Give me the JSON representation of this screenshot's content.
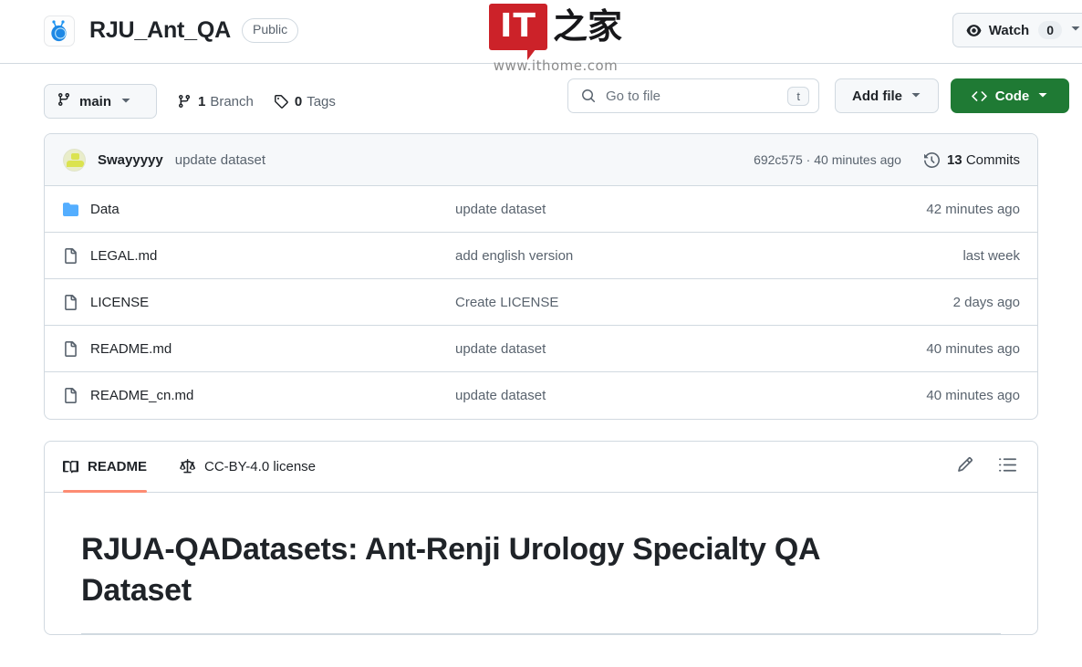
{
  "header": {
    "repo_name": "RJU_Ant_QA",
    "visibility": "Public",
    "logo_icon": "ant-logo-icon",
    "watch": {
      "icon": "eye-icon",
      "label": "Watch",
      "count": "0",
      "caret_icon": "chevron-down-icon"
    }
  },
  "watermark": {
    "logo_text": "IT",
    "logo_cn": "之家",
    "url": "www.ithome.com",
    "brand_color": "#cc2229"
  },
  "toolbar": {
    "branch_icon": "branch-icon",
    "branch_name": "main",
    "branch_caret_icon": "chevron-down-icon",
    "branches": {
      "icon": "branch-icon",
      "count": "1",
      "label": "Branch"
    },
    "tags": {
      "icon": "tag-icon",
      "count": "0",
      "label": "Tags"
    },
    "search": {
      "icon": "search-icon",
      "placeholder": "Go to file",
      "value": "",
      "shortcut": "t"
    },
    "add_file": {
      "label": "Add file",
      "caret_icon": "chevron-down-icon"
    },
    "code": {
      "icon": "code-brackets-icon",
      "label": "Code",
      "caret_icon": "chevron-down-icon",
      "color": "#1f7a34"
    }
  },
  "commit_bar": {
    "avatar": "user-avatar",
    "author": "Swayyyyy",
    "message": "update dataset",
    "sha_and_time": "692c575 · 40 minutes ago",
    "history_icon": "history-clock-icon",
    "commits_count": "13",
    "commits_label": "Commits"
  },
  "files": [
    {
      "icon": "folder-icon",
      "name": "Data",
      "commit": "update dataset",
      "time": "42 minutes ago"
    },
    {
      "icon": "file-icon",
      "name": "LEGAL.md",
      "commit": "add english version",
      "time": "last week"
    },
    {
      "icon": "file-icon",
      "name": "LICENSE",
      "commit": "Create LICENSE",
      "time": "2 days ago"
    },
    {
      "icon": "file-icon",
      "name": "README.md",
      "commit": "update dataset",
      "time": "40 minutes ago"
    },
    {
      "icon": "file-icon",
      "name": "README_cn.md",
      "commit": "update dataset",
      "time": "40 minutes ago"
    }
  ],
  "readme": {
    "tabs": [
      {
        "icon": "book-icon",
        "label": "README",
        "active": true
      },
      {
        "icon": "law-scales-icon",
        "label": "CC-BY-4.0 license",
        "active": false
      }
    ],
    "edit_icon": "pencil-icon",
    "outline_icon": "outline-list-icon",
    "heading": "RJUA-QADatasets: Ant-Renji Urology Specialty QA Dataset",
    "accent_color": "#fd8c73"
  }
}
